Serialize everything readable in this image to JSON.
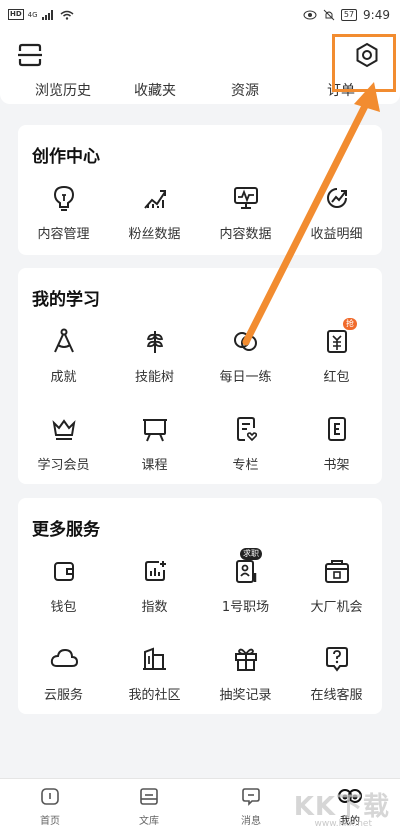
{
  "status_bar": {
    "left_badge": "HD",
    "signal": "4G",
    "battery": "57",
    "time": "9:49"
  },
  "header": {
    "scan_icon": "scan-icon",
    "settings_icon": "settings-icon"
  },
  "quick_links": [
    {
      "label": "浏览历史"
    },
    {
      "label": "收藏夹"
    },
    {
      "label": "资源"
    },
    {
      "label": "订单"
    }
  ],
  "creation": {
    "title": "创作中心",
    "items": [
      {
        "label": "内容管理",
        "icon": "lightbulb-icon"
      },
      {
        "label": "粉丝数据",
        "icon": "bar-chart-icon"
      },
      {
        "label": "内容数据",
        "icon": "monitor-chart-icon"
      },
      {
        "label": "收益明细",
        "icon": "trend-circle-icon"
      }
    ]
  },
  "study": {
    "title": "我的学习",
    "items": [
      {
        "label": "成就",
        "icon": "compass-icon"
      },
      {
        "label": "技能树",
        "icon": "wheat-icon"
      },
      {
        "label": "每日一练",
        "icon": "overlap-circles-icon"
      },
      {
        "label": "红包",
        "icon": "red-envelope-icon",
        "badge": "抢"
      },
      {
        "label": "学习会员",
        "icon": "crown-icon"
      },
      {
        "label": "课程",
        "icon": "easel-icon"
      },
      {
        "label": "专栏",
        "icon": "column-doc-icon"
      },
      {
        "label": "书架",
        "icon": "book-e-icon"
      }
    ]
  },
  "services": {
    "title": "更多服务",
    "items": [
      {
        "label": "钱包",
        "icon": "wallet-icon"
      },
      {
        "label": "指数",
        "icon": "index-chart-icon"
      },
      {
        "label": "1号职场",
        "icon": "resume-icon",
        "badge": "求职"
      },
      {
        "label": "大厂机会",
        "icon": "briefcase-icon"
      },
      {
        "label": "云服务",
        "icon": "cloud-icon"
      },
      {
        "label": "我的社区",
        "icon": "community-icon"
      },
      {
        "label": "抽奖记录",
        "icon": "gift-icon"
      },
      {
        "label": "在线客服",
        "icon": "help-chat-icon"
      }
    ]
  },
  "bottom_nav": [
    {
      "label": "首页",
      "icon": "home-icon"
    },
    {
      "label": "文库",
      "icon": "library-icon"
    },
    {
      "label": "消息",
      "icon": "message-icon"
    },
    {
      "label": "我的",
      "icon": "profile-icon"
    }
  ],
  "watermark": {
    "text": "KK下载",
    "url": "www.kkx.net"
  },
  "colors": {
    "accent": "#f28c30",
    "badge": "#f06a2b"
  }
}
